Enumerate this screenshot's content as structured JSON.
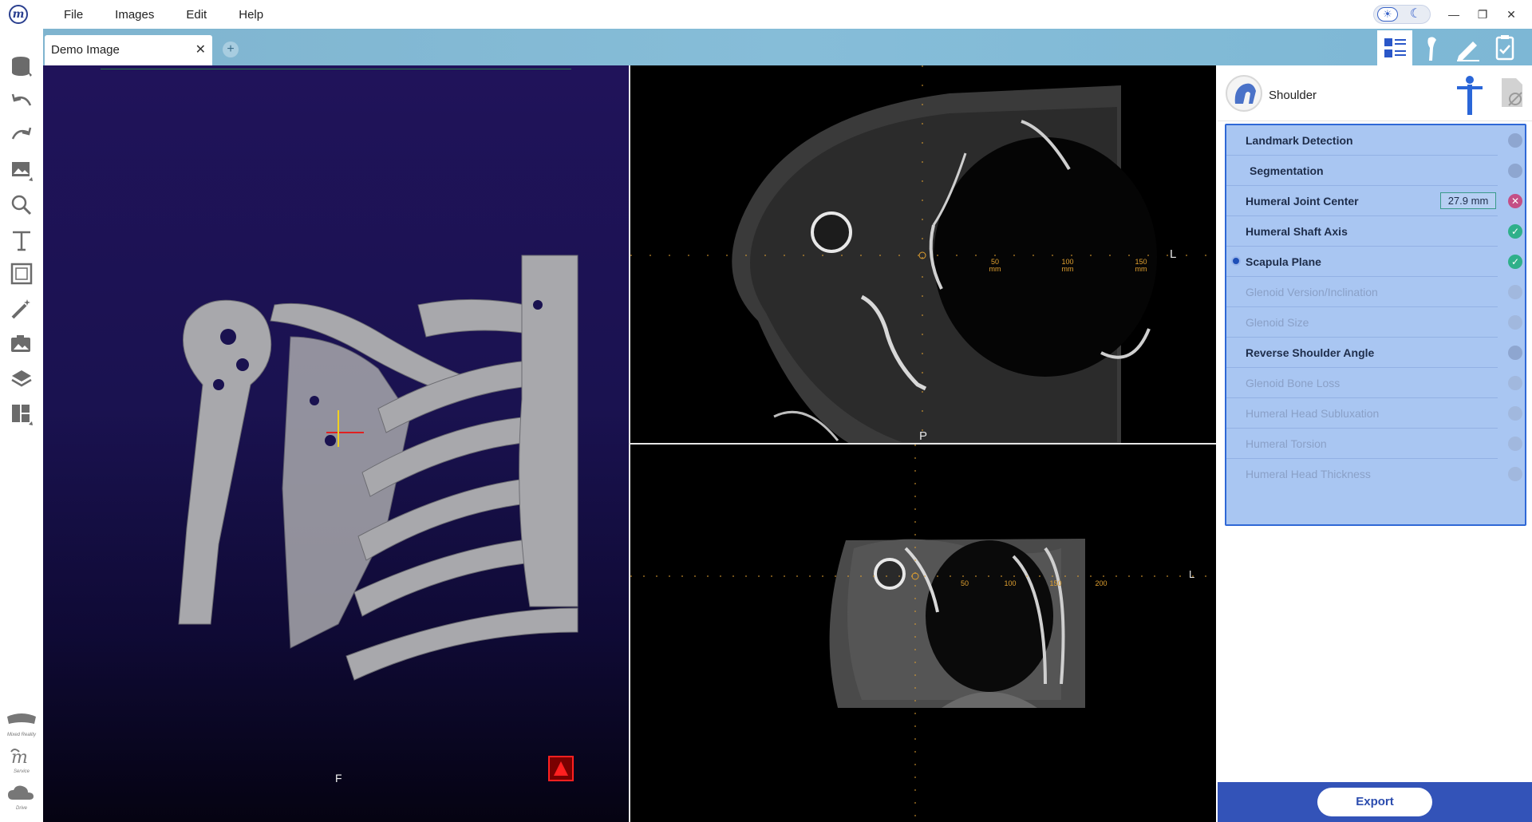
{
  "menu": {
    "items": [
      {
        "label": "File"
      },
      {
        "label": "Images"
      },
      {
        "label": "Edit"
      },
      {
        "label": "Help"
      }
    ]
  },
  "tabs": [
    {
      "title": "Demo Image",
      "close": "✕"
    }
  ],
  "add_tab": "+",
  "window_controls": {
    "minimize": "—",
    "maximize": "❐",
    "close": "✕"
  },
  "left_toolbar": {
    "tools": [
      "database-icon",
      "undo-icon",
      "redo-icon",
      "image-edit-icon",
      "zoom-icon",
      "text-icon",
      "frame-icon",
      "magic-wand-icon",
      "screenshot-icon",
      "layers-icon",
      "layout-icon"
    ],
    "bottom": [
      {
        "icon": "mixed-reality-icon",
        "label": "Mixed Reality"
      },
      {
        "icon": "service-icon",
        "label": "Service"
      },
      {
        "icon": "cloud-drive-icon",
        "label": "Drive"
      }
    ]
  },
  "viewports": {
    "volume": {
      "orientation_bottom": "F"
    },
    "axial": {
      "orientation_right": "L",
      "orientation_bottom": "P",
      "scale_labels": [
        {
          "value": "50",
          "unit": "mm"
        },
        {
          "value": "100",
          "unit": "mm"
        },
        {
          "value": "150",
          "unit": "mm"
        }
      ]
    },
    "coronal": {
      "orientation_right": "L",
      "scale_labels": [
        "50",
        "100",
        "150",
        "200"
      ]
    }
  },
  "panel": {
    "title": "Shoulder",
    "workflow": [
      {
        "label": "Landmark Detection",
        "state": "pending",
        "enabled": true
      },
      {
        "label": "Segmentation",
        "state": "pending",
        "enabled": true
      },
      {
        "label": "Humeral Joint Center",
        "state": "error",
        "enabled": true,
        "value": "27.9 mm"
      },
      {
        "label": "Humeral Shaft Axis",
        "state": "done",
        "enabled": true
      },
      {
        "label": "Scapula Plane",
        "state": "done",
        "enabled": true,
        "current": true
      },
      {
        "label": "Glenoid Version/Inclination",
        "state": "pending",
        "enabled": false
      },
      {
        "label": "Glenoid Size",
        "state": "pending",
        "enabled": false
      },
      {
        "label": "Reverse Shoulder Angle",
        "state": "pending",
        "enabled": true
      },
      {
        "label": "Glenoid Bone Loss",
        "state": "pending",
        "enabled": false
      },
      {
        "label": "Humeral Head Subluxation",
        "state": "pending",
        "enabled": false
      },
      {
        "label": "Humeral Torsion",
        "state": "pending",
        "enabled": false
      },
      {
        "label": "Humeral Head Thickness",
        "state": "pending",
        "enabled": false
      }
    ],
    "export_label": "Export"
  },
  "colors": {
    "accent": "#3353b8",
    "workflow_bg": "#a9c6f2",
    "done": "#2fb08a",
    "error": "#c44f86",
    "ruler": "#e0a030"
  }
}
